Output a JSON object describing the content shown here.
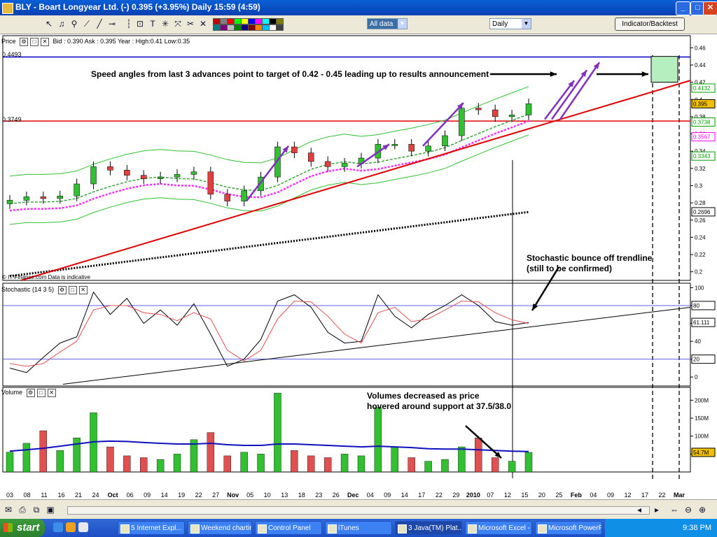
{
  "window": {
    "title": "BLY - Boart Longyear Ltd. (-)     0.395 (+3.95%)    Daily  15:59 (4:59)",
    "controls": [
      "_",
      "□",
      "✕"
    ]
  },
  "toolbar": {
    "data_range": "All data",
    "period": "Daily",
    "indicator_button": "Indicator/Backtest",
    "colors": [
      "#c00000",
      "#808080",
      "#ff0000",
      "#00ff00",
      "#ffff00",
      "#0000ff",
      "#ff00ff",
      "#00ffff",
      "#000000",
      "#808000",
      "#008080",
      "#800080",
      "#c0c0c0",
      "#008000",
      "#000080",
      "#800000",
      "#ff8000",
      "#00c0ff",
      "#ffffff",
      "#404040"
    ]
  },
  "price_pane": {
    "header": "Price",
    "quote": "Bid : 0.390  Ask : 0.395   Year : High:0.41  Low:0.35",
    "level_top_label": "0.4493",
    "level_support_label": "0.3749",
    "watermark": "© IT-Finance.com  Data is indicative",
    "y_ticks": [
      "0.46",
      "0.44",
      "0.42",
      "0.4",
      "0.38",
      "0.36",
      "0.34",
      "0.32",
      "0.3",
      "0.28",
      "0.26",
      "0.24",
      "0.22",
      "0.2"
    ],
    "value_tags": [
      {
        "text": "0.4132",
        "color": "#00a000"
      },
      {
        "text": "0.395",
        "color": "#000000",
        "bg": "#f0c000"
      },
      {
        "text": "0.3738",
        "color": "#00a000"
      },
      {
        "text": "0.3567",
        "color": "#ff00ff"
      },
      {
        "text": "0.3343",
        "color": "#00a000"
      },
      {
        "text": "0.2696",
        "color": "#000000"
      }
    ]
  },
  "stoch_pane": {
    "header": "Stochastic (14 3 5)",
    "y_ticks": [
      "100",
      "80",
      "60",
      "40",
      "20",
      "0"
    ],
    "value_tags": [
      "80",
      "61.111",
      "20"
    ]
  },
  "volume_pane": {
    "header": "Volume",
    "y_ticks": [
      "200M",
      "150M",
      "100M",
      "50M"
    ],
    "value_tag": "54.7M"
  },
  "annotations": {
    "speed_angles": "Speed angles from last 3 advances point to target of  0.42 - 0.45 leading up to results announcement",
    "stoch_bounce": "Stochastic bounce off trendline\n(still to be confirmed)",
    "volumes": "Volumes decreased as price\nhovered around support at 37.5/38.0"
  },
  "x_axis": {
    "labels": [
      "03",
      "08",
      "11",
      "16",
      "21",
      "24",
      "Oct",
      "06",
      "09",
      "14",
      "19",
      "22",
      "27",
      "Nov",
      "05",
      "10",
      "13",
      "18",
      "23",
      "26",
      "Dec",
      "04",
      "09",
      "14",
      "17",
      "22",
      "29",
      "2010",
      "07",
      "12",
      "15",
      "20",
      "25",
      "Feb",
      "04",
      "09",
      "12",
      "17",
      "22",
      "Mar"
    ]
  },
  "taskbar": {
    "start": "start",
    "items": [
      "5 Internet Expl...",
      "Weekend chartin...",
      "Control Panel",
      "iTunes",
      "3 Java(TM) Plat...",
      "Microsoft Excel - ...",
      "Microsoft PowerP..."
    ],
    "clock": "9:38 PM"
  },
  "chart_data": [
    {
      "type": "candlestick",
      "title": "BLY - Boart Longyear Ltd. (-)",
      "ylim": [
        0.19,
        0.47
      ],
      "x": [
        "03",
        "08",
        "11",
        "16",
        "21",
        "24",
        "Oct",
        "06",
        "09",
        "14",
        "19",
        "22",
        "27",
        "Nov",
        "05",
        "10",
        "13",
        "18",
        "23",
        "26",
        "Dec",
        "04",
        "09",
        "14",
        "17",
        "22",
        "29",
        "2010",
        "07",
        "12",
        "15",
        "20"
      ],
      "close": [
        0.283,
        0.287,
        0.285,
        0.288,
        0.302,
        0.322,
        0.318,
        0.312,
        0.308,
        0.31,
        0.313,
        0.316,
        0.29,
        0.282,
        0.294,
        0.31,
        0.345,
        0.338,
        0.328,
        0.322,
        0.326,
        0.332,
        0.348,
        0.348,
        0.34,
        0.346,
        0.358,
        0.39,
        0.388,
        0.38,
        0.382,
        0.395
      ],
      "horizontal_levels": [
        0.4493,
        0.3749
      ],
      "target_range": [
        0.42,
        0.45
      ]
    },
    {
      "type": "line",
      "title": "Stochastic (14 3 5)",
      "ylim": [
        -10,
        105
      ],
      "x": [
        "03",
        "08",
        "11",
        "16",
        "21",
        "24",
        "Oct",
        "06",
        "09",
        "14",
        "19",
        "22",
        "27",
        "Nov",
        "05",
        "10",
        "13",
        "18",
        "23",
        "26",
        "Dec",
        "04",
        "09",
        "14",
        "17",
        "22",
        "29",
        "2010",
        "07",
        "12",
        "15",
        "20"
      ],
      "series": [
        {
          "values": [
            10,
            5,
            22,
            38,
            45,
            95,
            70,
            88,
            60,
            75,
            58,
            82,
            48,
            12,
            20,
            42,
            85,
            92,
            78,
            50,
            38,
            40,
            92,
            68,
            55,
            70,
            80,
            92,
            80,
            62,
            58,
            61
          ]
        },
        {
          "values": [
            15,
            12,
            15,
            28,
            40,
            75,
            80,
            80,
            72,
            70,
            63,
            72,
            65,
            30,
            18,
            30,
            65,
            85,
            84,
            68,
            48,
            38,
            72,
            78,
            62,
            65,
            75,
            85,
            84,
            72,
            64,
            60
          ]
        }
      ],
      "levels": [
        80,
        20
      ]
    },
    {
      "type": "bar",
      "title": "Volume",
      "ylim": [
        0,
        230
      ],
      "x": [
        "03",
        "08",
        "11",
        "16",
        "21",
        "24",
        "Oct",
        "06",
        "09",
        "14",
        "19",
        "22",
        "27",
        "Nov",
        "05",
        "10",
        "13",
        "18",
        "23",
        "26",
        "Dec",
        "04",
        "09",
        "14",
        "17",
        "22",
        "29",
        "2010",
        "07",
        "12",
        "15",
        "20"
      ],
      "values": [
        55,
        80,
        115,
        60,
        95,
        165,
        70,
        45,
        40,
        35,
        50,
        90,
        110,
        45,
        55,
        50,
        220,
        60,
        45,
        40,
        50,
        45,
        180,
        70,
        40,
        30,
        35,
        70,
        95,
        40,
        30,
        54.7
      ],
      "avg_line": [
        58,
        62,
        66,
        72,
        78,
        84,
        86,
        85,
        82,
        80,
        78,
        78,
        80,
        76,
        74,
        74,
        78,
        78,
        76,
        74,
        72,
        70,
        72,
        70,
        68,
        65,
        64,
        64,
        62,
        60,
        58,
        57
      ]
    }
  ]
}
